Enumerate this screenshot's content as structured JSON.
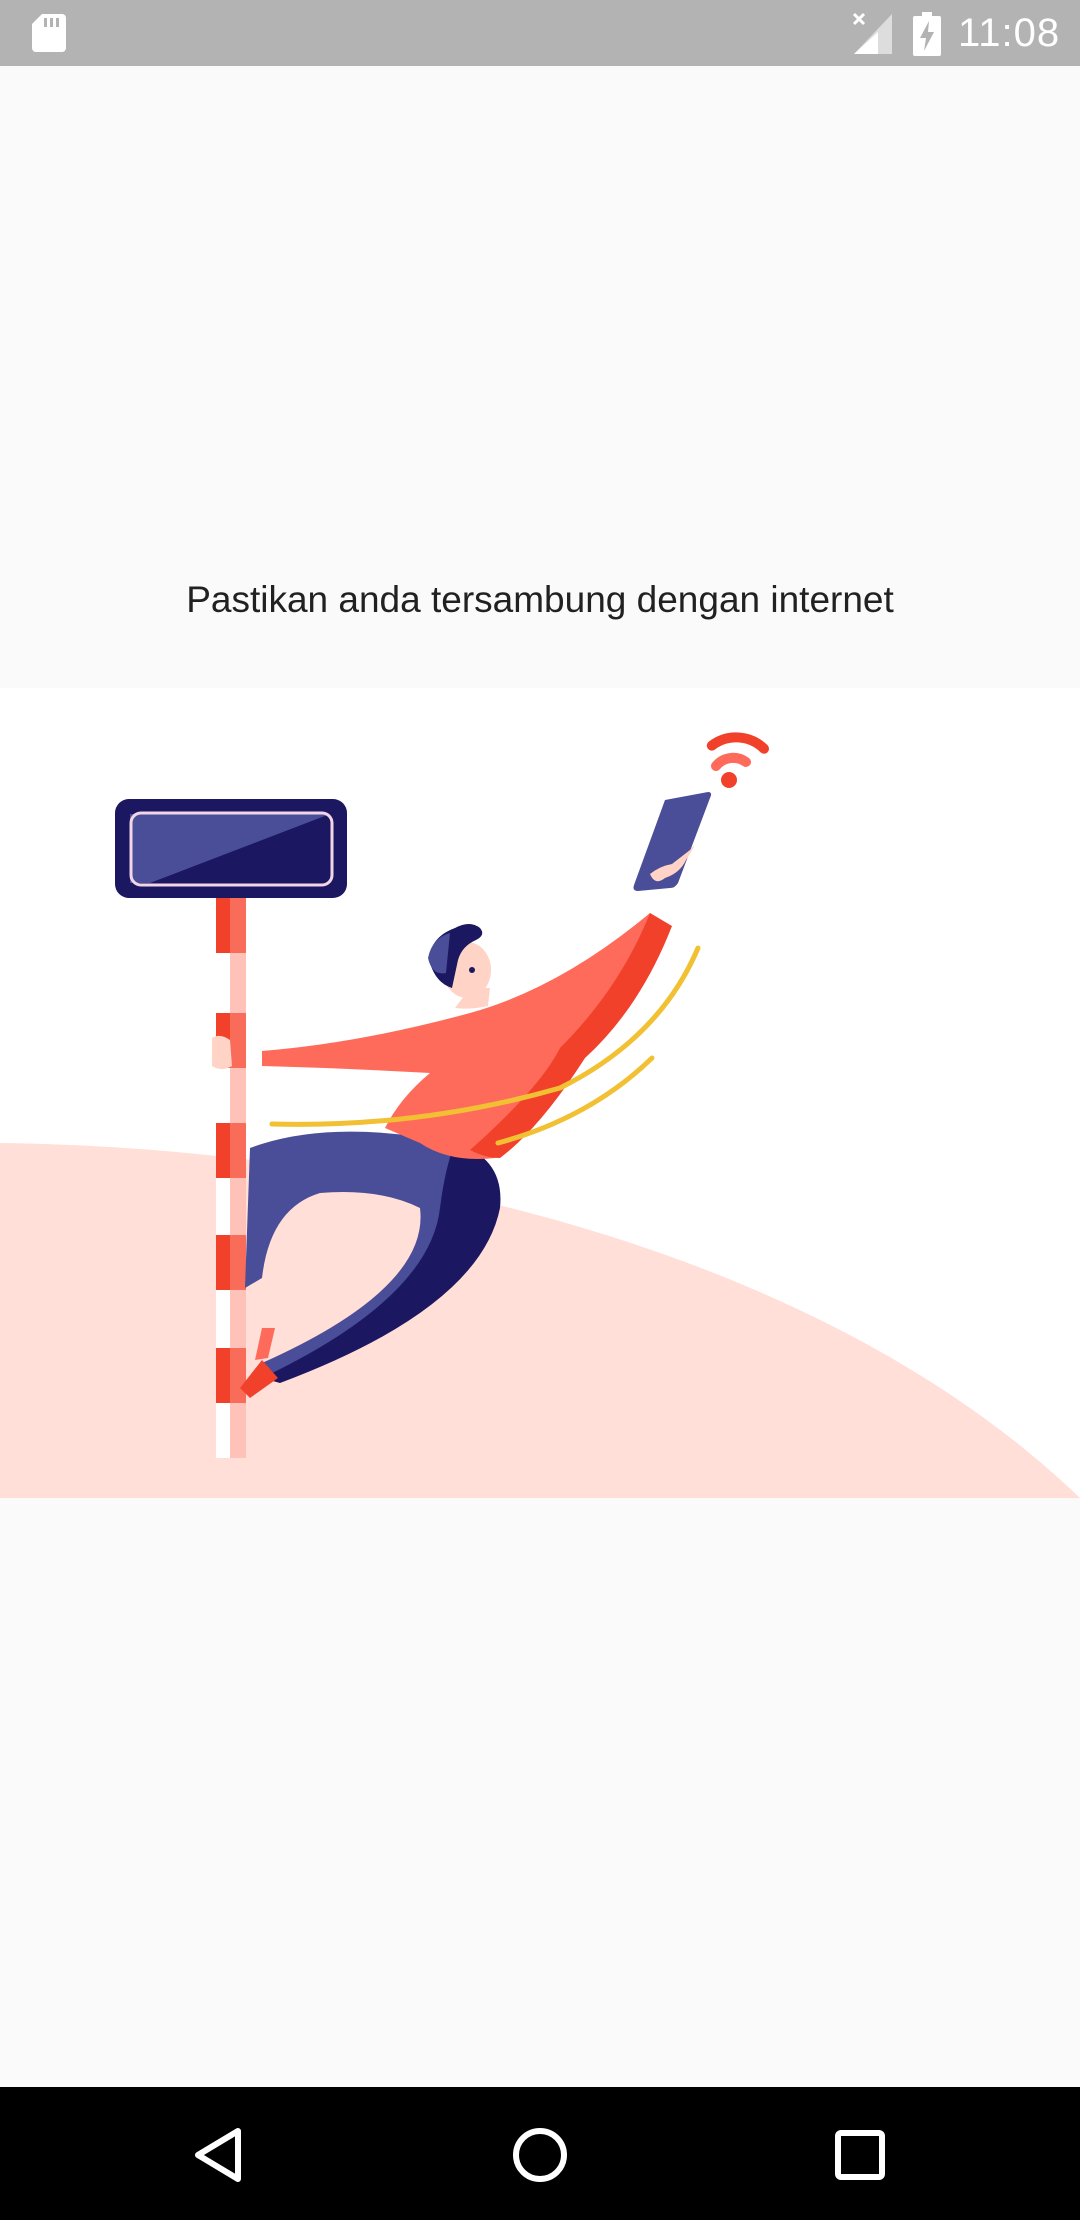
{
  "status_bar": {
    "time": "11:08",
    "icons": [
      "sd-card-icon",
      "no-signal-icon",
      "battery-charging-icon"
    ]
  },
  "message": {
    "text": "Pastikan anda tersambung dengan internet"
  },
  "illustration": {
    "name": "no-internet-illustration"
  },
  "navigation": {
    "buttons": [
      "back-icon",
      "home-icon",
      "recents-icon"
    ]
  },
  "colors": {
    "background": "#fafafa",
    "status_bar": "#b3b3b3",
    "accent_orange": "#ff6b5b",
    "accent_red": "#f2412a",
    "navy": "#1b1760",
    "indigo": "#4a4d97",
    "peach": "#ffdfd7",
    "yellow": "#f2c033"
  }
}
